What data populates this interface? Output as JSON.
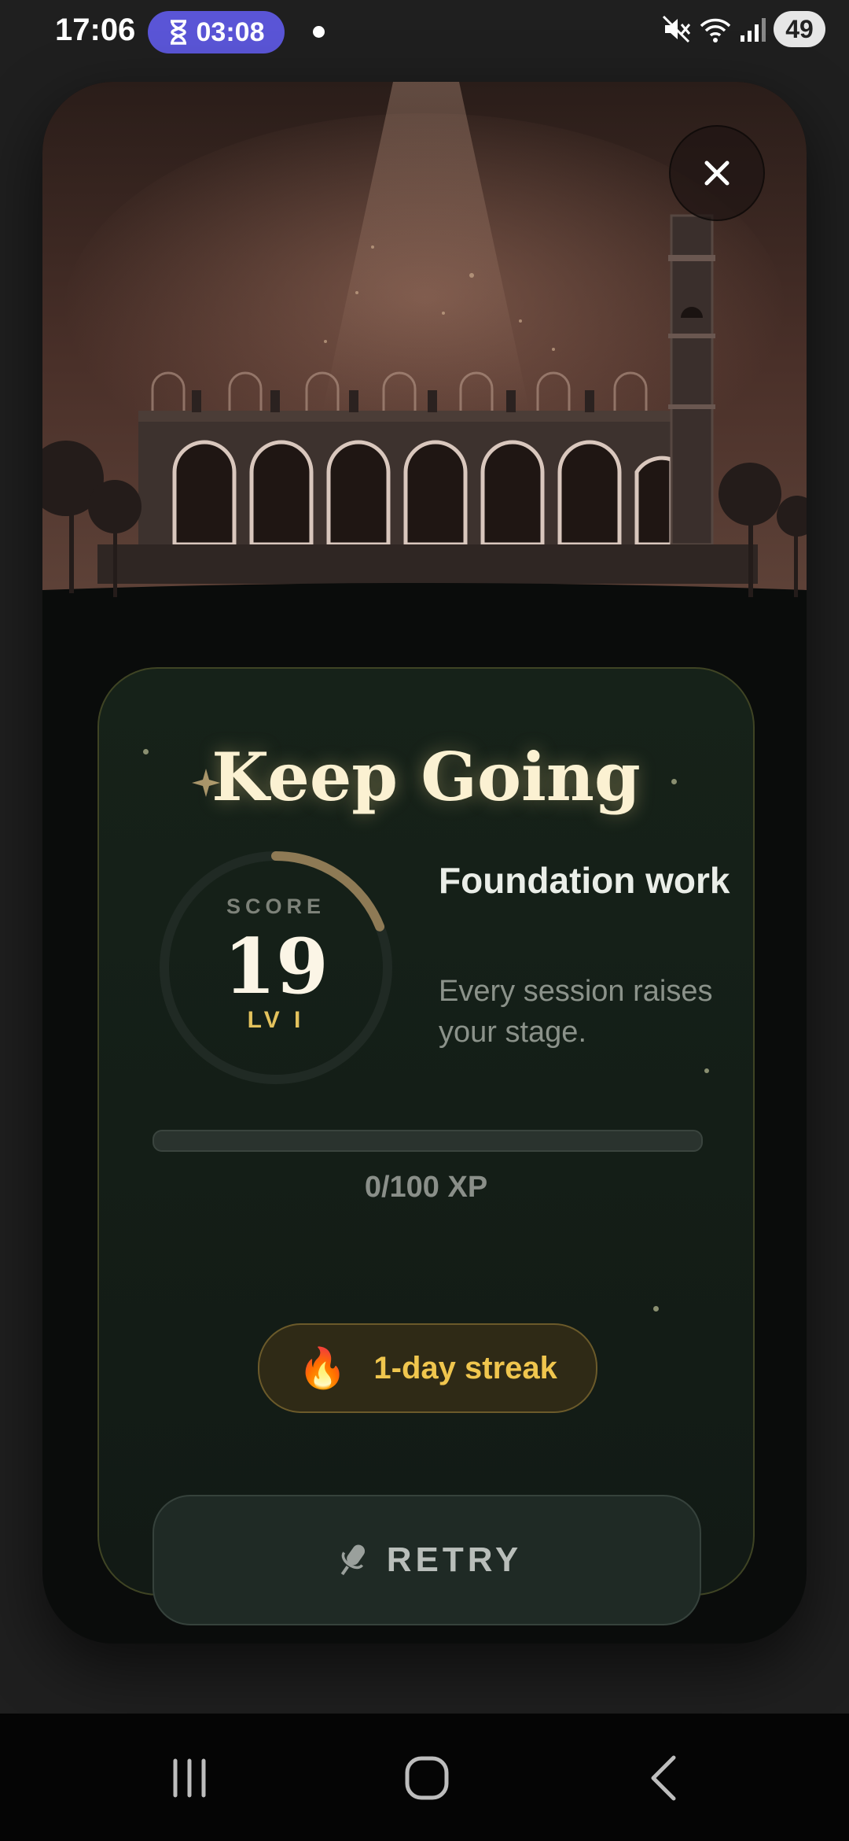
{
  "status_bar": {
    "time": "17:06",
    "timer": "03:08",
    "battery": "49",
    "icons": [
      "hourglass-icon",
      "mute-icon",
      "wifi-icon",
      "signal-icon"
    ]
  },
  "modal": {
    "title": "Keep Going",
    "score": {
      "label": "SCORE",
      "value": "19",
      "level": "LV I",
      "ring_progress": 0.19
    },
    "stage": {
      "title": "Foundation work",
      "description": "Every session raises your stage."
    },
    "xp": {
      "text": "0/100 XP",
      "current": 0,
      "max": 100
    },
    "streak": {
      "icon": "fire-icon",
      "label": "1-day streak"
    },
    "retry": {
      "icon": "microphone-icon",
      "label": "RETRY"
    }
  },
  "nav_bar": {
    "buttons": [
      "recents",
      "home",
      "back"
    ]
  },
  "colors": {
    "accent_gold": "#e3c25d",
    "streak_text": "#f0c64e",
    "title_cream": "#fbf1d2",
    "timer_pill": "#5a55d6",
    "card_bg": "#162219"
  }
}
